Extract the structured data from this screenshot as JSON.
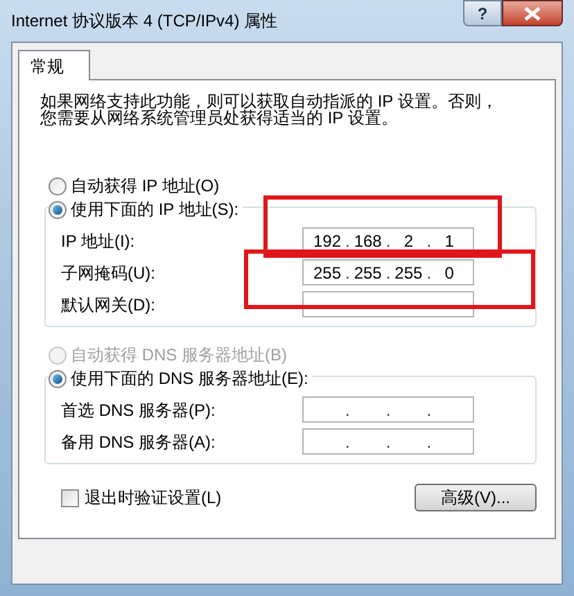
{
  "window": {
    "title": "Internet 协议版本 4 (TCP/IPv4) 属性",
    "help_button": "?"
  },
  "tabs": [
    {
      "label": "常规",
      "selected": true
    }
  ],
  "description": [
    "如果网络支持此功能，则可以获取自动指派的 IP 设置。否则，",
    "您需要从网络系统管理员处获得适当的 IP 设置。"
  ],
  "octet_separator": ".",
  "sections": [
    {
      "options": [
        {
          "label": "自动获得 IP 地址(O)",
          "selected": false,
          "disabled": false
        },
        {
          "label": "使用下面的 IP 地址(S):",
          "selected": true,
          "disabled": false
        }
      ],
      "fields": [
        {
          "label": "IP 地址(I):",
          "octets": [
            "192",
            "168",
            "2",
            "1"
          ]
        },
        {
          "label": "子网掩码(U):",
          "octets": [
            "255",
            "255",
            "255",
            "0"
          ]
        },
        {
          "label": "默认网关(D):"
        }
      ]
    },
    {
      "options": [
        {
          "label": "自动获得 DNS 服务器地址(B)",
          "selected": false,
          "disabled": true
        },
        {
          "label": "使用下面的 DNS 服务器地址(E):",
          "selected": true,
          "disabled": false
        }
      ],
      "fields": [
        {
          "label": "首选 DNS 服务器(P):",
          "octets_shown": true
        },
        {
          "label": "备用 DNS 服务器(A):",
          "octets_shown": true
        }
      ]
    }
  ],
  "validate_on_exit": {
    "label": "退出时验证设置(L)",
    "checked": false
  },
  "advanced_button": "高级(V)..."
}
